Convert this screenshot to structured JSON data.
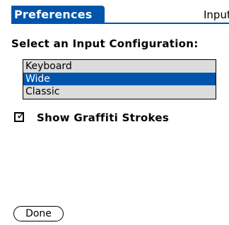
{
  "title_bar": {
    "title": "Preferences",
    "category": "Input"
  },
  "prompt": "Select an Input Configuration:",
  "list": {
    "items": [
      {
        "label": "Keyboard",
        "selected": false
      },
      {
        "label": "Wide",
        "selected": true
      },
      {
        "label": "Classic",
        "selected": false
      }
    ]
  },
  "checkbox": {
    "label": "Show Graffiti Strokes",
    "checked": true
  },
  "buttons": {
    "done_label": "Done"
  },
  "colors": {
    "accent": "#0055aa",
    "list_background": "#dcdcdc"
  }
}
